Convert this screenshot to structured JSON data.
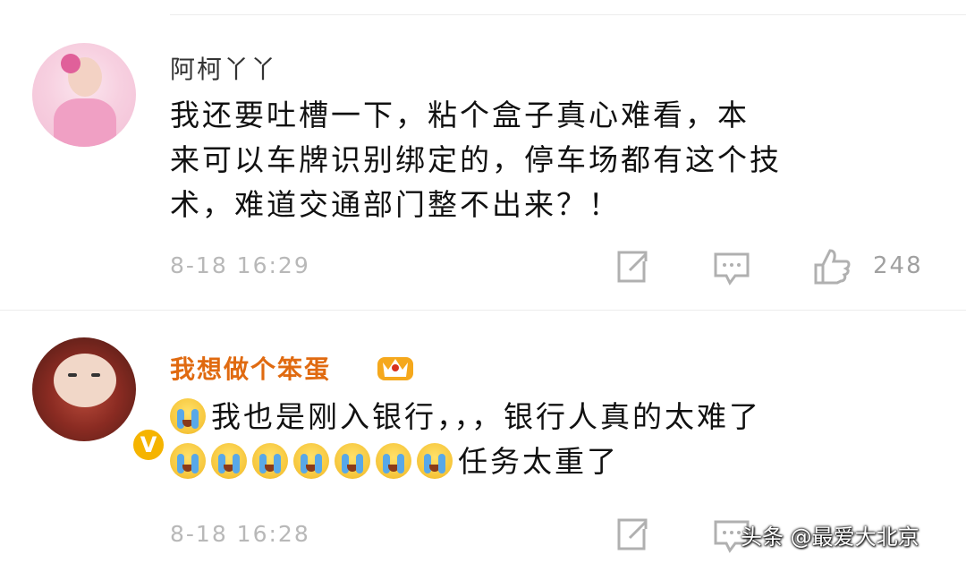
{
  "comments": [
    {
      "username": "阿柯丫丫",
      "lines": [
        "我还要吐槽一下，粘个盒子真心难看，本",
        "来可以车牌识别绑定的，停车场都有这个技",
        "术，难道交通部门整不出来？！"
      ],
      "timestamp": "8-18 16:29",
      "like_count": "248"
    },
    {
      "username": "我想做个笨蛋",
      "line1": "我也是刚入银行，，，银行人真的太难了",
      "line2_suffix": "任务太重了",
      "verified_badge": "V",
      "timestamp": "8-18 16:28"
    }
  ],
  "watermark": "头条 @最爱大北京",
  "colors": {
    "username_default": "#333333",
    "username_vip": "#e06a10",
    "meta_gray": "#b8b8b8",
    "verified": "#f5b400"
  },
  "icons": [
    "share-icon",
    "reply-icon",
    "like-icon",
    "crown-icon",
    "crying-face-icon",
    "verified-icon"
  ]
}
